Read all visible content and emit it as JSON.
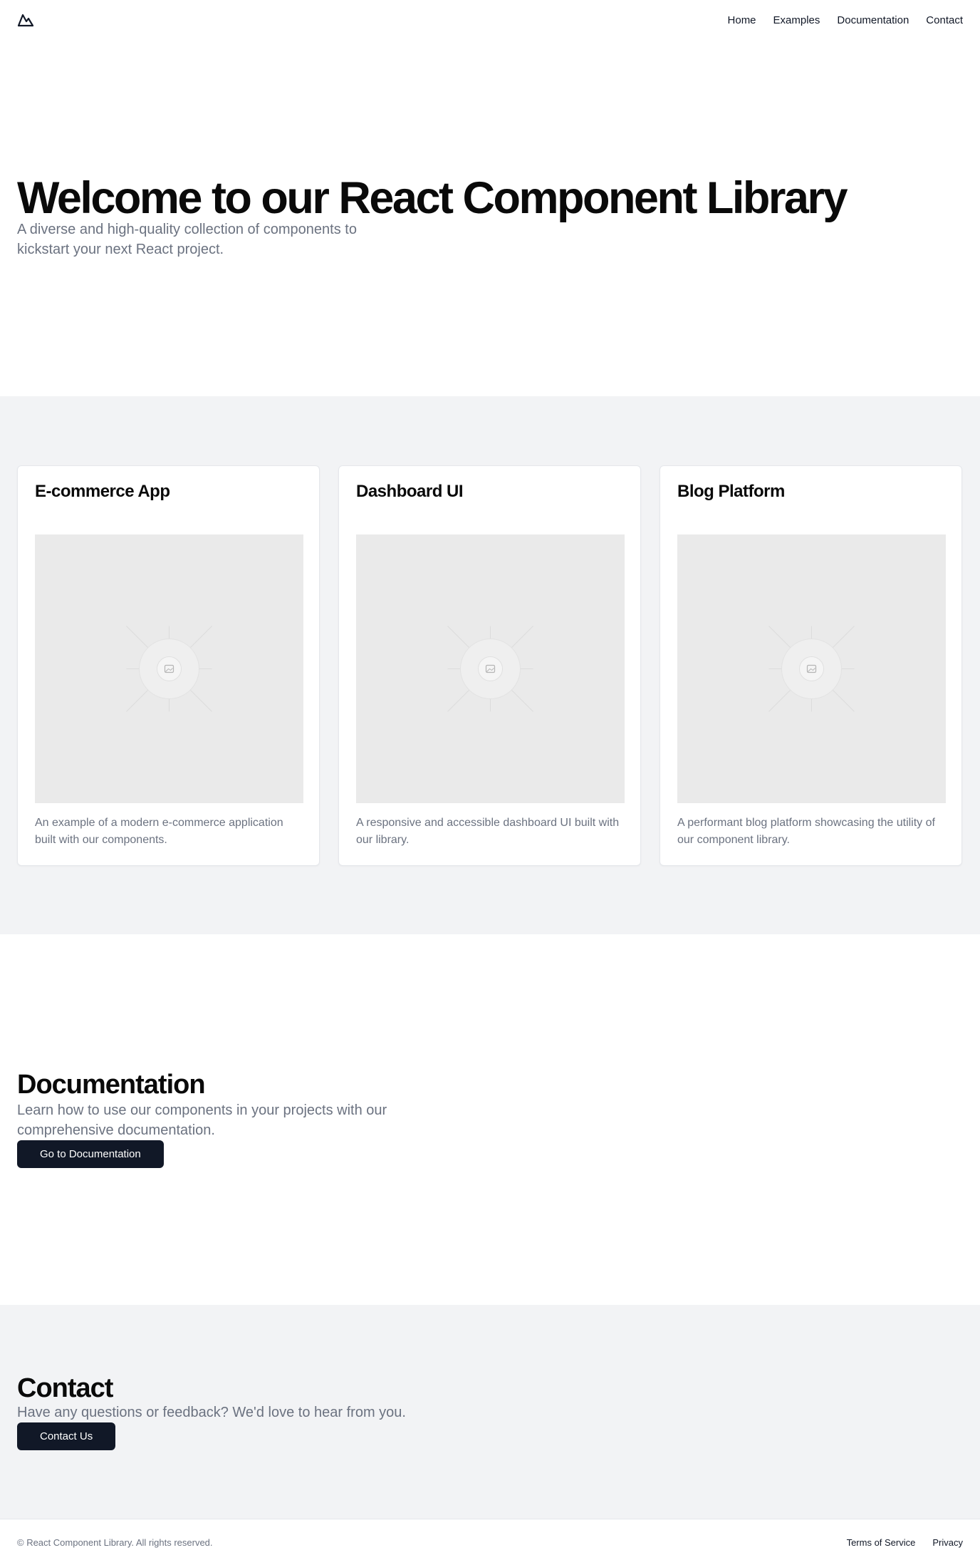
{
  "header": {
    "logo_icon": "mountain-icon",
    "nav": [
      {
        "label": "Home"
      },
      {
        "label": "Examples"
      },
      {
        "label": "Documentation"
      },
      {
        "label": "Contact"
      }
    ]
  },
  "hero": {
    "title": "Welcome to our React Component Library",
    "subtitle": "A diverse and high-quality collection of components to kickstart your next React project."
  },
  "examples": {
    "cards": [
      {
        "title": "E-commerce App",
        "description": "An example of a modern e-commerce application built with our components.",
        "image_icon": "image-placeholder-icon"
      },
      {
        "title": "Dashboard UI",
        "description": "A responsive and accessible dashboard UI built with our library.",
        "image_icon": "image-placeholder-icon"
      },
      {
        "title": "Blog Platform",
        "description": "A performant blog platform showcasing the utility of our component library.",
        "image_icon": "image-placeholder-icon"
      }
    ]
  },
  "documentation": {
    "title": "Documentation",
    "text": "Learn how to use our components in your projects with our comprehensive documentation.",
    "button_label": "Go to Documentation"
  },
  "contact": {
    "title": "Contact",
    "text": "Have any questions or feedback? We'd love to hear from you.",
    "button_label": "Contact Us"
  },
  "footer": {
    "copyright": "© React Component Library. All rights reserved.",
    "links": [
      {
        "label": "Terms of Service"
      },
      {
        "label": "Privacy"
      }
    ]
  },
  "colors": {
    "primary_button": "#111827",
    "muted_text": "#6b7280",
    "section_bg": "#f2f3f5",
    "placeholder_bg": "#eaeaea"
  }
}
